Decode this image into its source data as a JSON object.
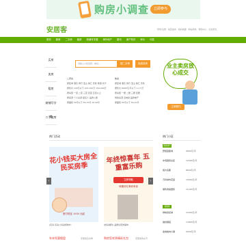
{
  "banner": {
    "title": "购房小调查",
    "cta": "立即参与"
  },
  "header": {
    "logo": "安居客",
    "city": "城市",
    "top_links": "登录/注册  · 免费发布 · 我的收藏 · 网站导航 · 帮助中心 · 反馈意见"
  },
  "nav": [
    "首页",
    "新房",
    "二手房",
    "租房",
    "商铺写字楼",
    "海外地产",
    "楼讯",
    "房产知识",
    "房价",
    "问答",
    "APP下载"
  ],
  "side_menu": [
    "买房",
    "卖房",
    "租房",
    "商铺写字楼",
    "二手查房"
  ],
  "search": {
    "placeholder": "请输入小区名称、地址…",
    "search_btn": "搜二手房",
    "find_btn": "免费找房"
  },
  "columns": {
    "col1_title": "二手房",
    "col1": [
      "按区域  浦东 闵行 宝山 徐汇 普陀 杨浦 长宁",
      "按售价  100万以下 100-150万 150-200万",
      "按房型  一室 二室 三室 四室 五室以上",
      "按来源  个人房源 经纪人 品牌公寓",
      "按面积  50平以下 50-70平 70-90平"
    ],
    "col2_title": "新房",
    "col2": [
      "按区域  浦东 闵行 宝山 徐汇 普陀",
      "按售价  8000元/平以下 1-1.5万",
      "按房型  一居 二居 三居 四居",
      "特色房源  近地铁 品牌地产",
      "按面积  50平以下 50-70平"
    ]
  },
  "promo": {
    "text": "业主卖房放心成交",
    "button": "立即委托"
  },
  "hot": {
    "title": "热门活动",
    "more": "更多",
    "card1": {
      "headline": "花小钱买大房全民买房季",
      "sub": "首付低至 1000 元起",
      "caption": "[买房·买房] 好房抢购中！",
      "link": "年末钜惠楼盘",
      "link2": "安居客买房季"
    },
    "card2": {
      "headline": "年终惊喜年 五重富乐购",
      "sub": "惊喜好礼等你来拿",
      "badge": "立即领取",
      "caption": "[抢房福利] 品质住宅热销中",
      "link": "购房狂欢季精彩礼包",
      "link2": "安居客购房节"
    }
  },
  "rank": {
    "title": "热门小区",
    "tags": [
      "楼盘排行",
      "热搜榜"
    ],
    "items": [
      {
        "name": "碧桂园星城",
        "price": "9800元/平"
      },
      {
        "name": "中海国际社区",
        "price": "12500元/平"
      },
      {
        "name": "恒大名都",
        "price": "8600元/平"
      },
      {
        "name": "万科城市花园",
        "price": "15600元/平"
      },
      {
        "name": "保利香槟国际",
        "price": "11200元/平"
      },
      {
        "name": "绿地世纪城",
        "price": "10300元/平"
      },
      {
        "name": "融创御园",
        "price": "13800元/平"
      },
      {
        "name": "金地格林小镇",
        "price": "9200元/平"
      }
    ]
  },
  "colors": {
    "brand_green": "#62ab00",
    "accent_orange": "#f49a2a",
    "alert_red": "#e5372f"
  }
}
